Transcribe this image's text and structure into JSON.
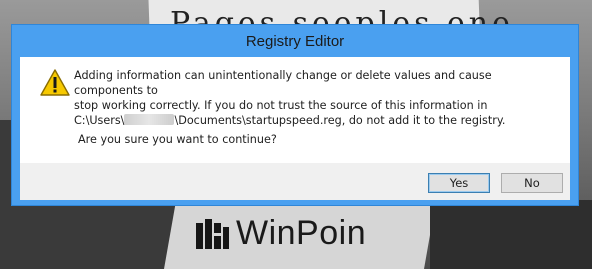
{
  "dialog": {
    "title": "Registry Editor",
    "message_line1": "Adding information can unintentionally change or delete values and cause components to",
    "message_line2": "stop working correctly. If you do not trust the source of this information in",
    "message_line3_prefix": "C:\\Users\\",
    "message_line3_suffix": "\\Documents\\startupspeed.reg, do not add it to the registry.",
    "question": "Are you sure you want to continue?",
    "yes_label": "Yes",
    "no_label": "No",
    "icon": "warning-icon"
  },
  "watermark": {
    "text": "WinPoin",
    "icon": "winpoin-logo-icon"
  },
  "colors": {
    "titlebar": "#4aa0f0",
    "warning_yellow": "#f7c900",
    "content_bg": "#ffffff",
    "footer_bg": "#f0f0f0"
  }
}
